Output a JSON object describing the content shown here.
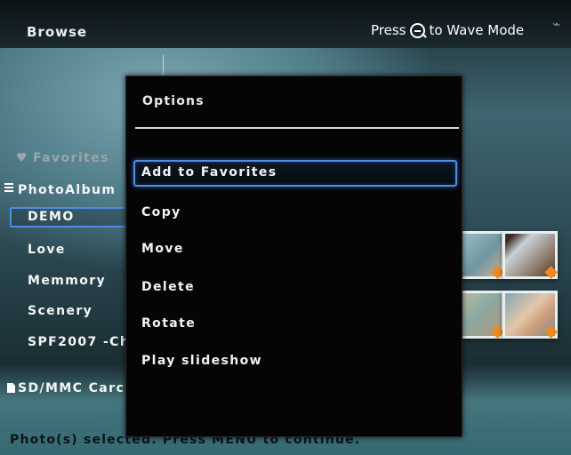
{
  "header": {
    "title": "Browse",
    "hint_prefix": "Press",
    "hint_suffix": "to Wave Mode",
    "hint_icon": "zoom-out-icon",
    "power_icon": "plug-icon"
  },
  "sidebar": {
    "favorites": "Favorites",
    "photoalbum": "PhotoAlbum",
    "albums": [
      "DEMO",
      "Love",
      "Memmory",
      "Scenery",
      "SPF2007 -Ch"
    ],
    "selected_album": "DEMO",
    "card": "SD/MMC Carc"
  },
  "options_menu": {
    "title": "Options",
    "items": [
      "Add to Favorites",
      "Copy",
      "Move",
      "Delete",
      "Rotate",
      "Play slideshow"
    ],
    "selected_item": "Add to Favorites"
  },
  "status": {
    "text": "Photo(s) selected. Press MENU to continue."
  },
  "colors": {
    "selection_border": "#4d8ce8",
    "dialog_bg": "#050505",
    "thumbnail_badge": "#f08a1c"
  }
}
